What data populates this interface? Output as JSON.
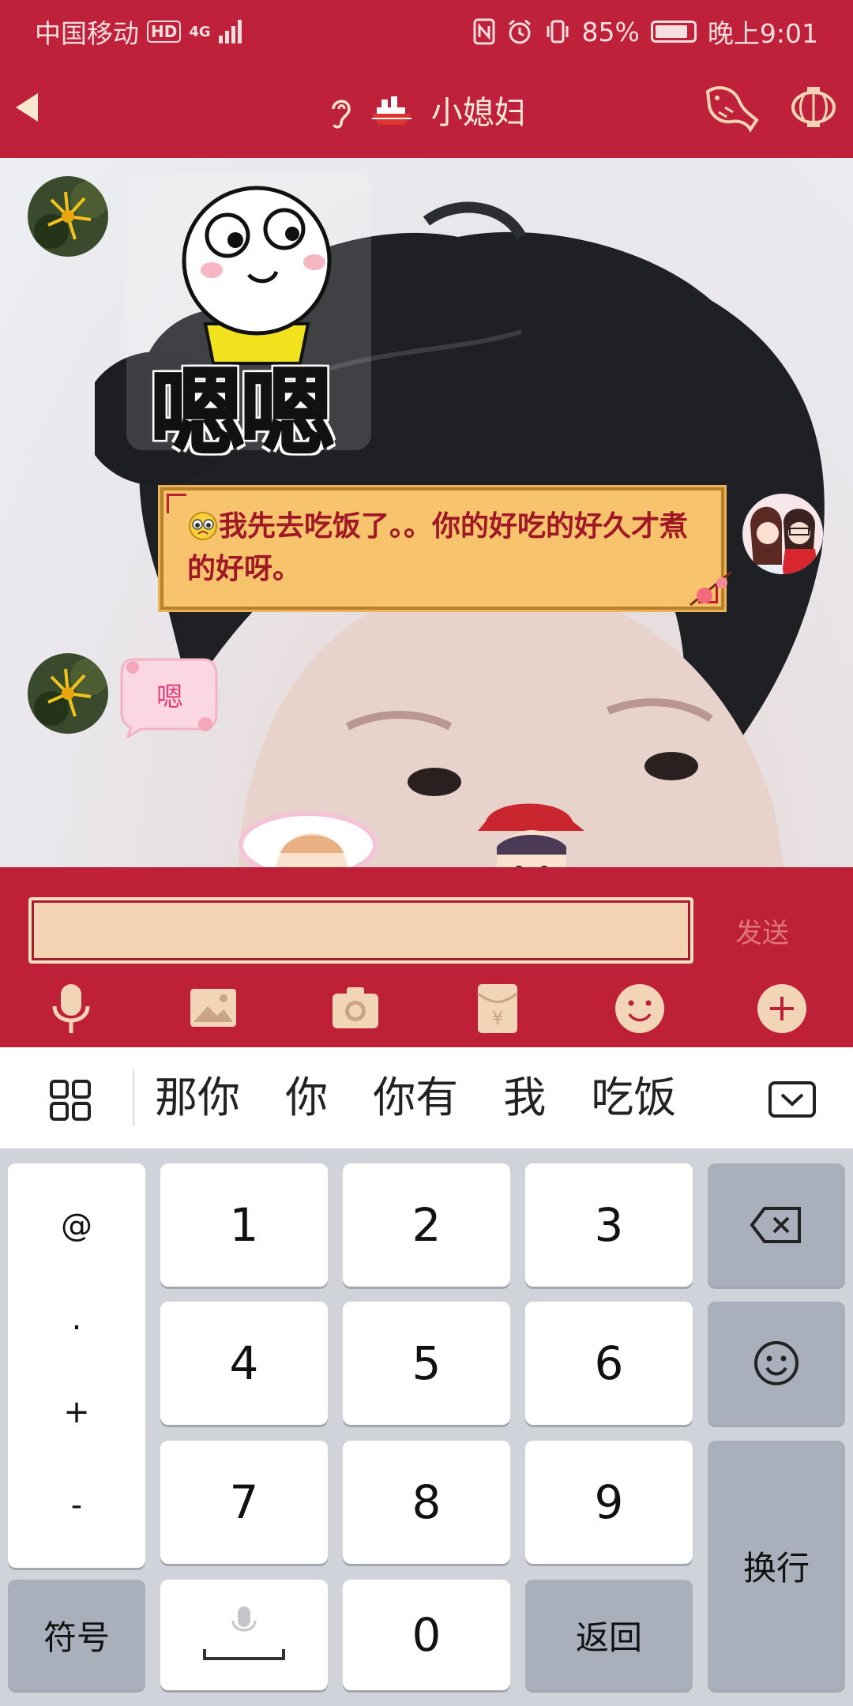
{
  "status_bar": {
    "carrier": "中国移动",
    "hd_badge": "HD",
    "network": "4G",
    "battery_percent": "85%",
    "time": "晚上9:01"
  },
  "header": {
    "title": "小媳妇",
    "icons": [
      "back-icon",
      "ear-icon",
      "ship-icon",
      "fish-icon",
      "lantern-icon"
    ]
  },
  "chat": {
    "sticker_text": "嗯嗯",
    "message_text": "我先去吃饭了。。你的好吃的好久才煮的好呀。",
    "small_sticker_text": "嗯"
  },
  "input_bar": {
    "input_value": "",
    "send_label": "发送",
    "tools": [
      "microphone-icon",
      "image-icon",
      "camera-icon",
      "red-packet-icon",
      "emoji-icon",
      "plus-icon"
    ]
  },
  "suggestions": {
    "candidates": [
      "那你",
      "你",
      "你有",
      "我",
      "吃饭"
    ]
  },
  "keyboard": {
    "symbols_col": [
      "@",
      ".",
      "+",
      "-"
    ],
    "digits": [
      "1",
      "2",
      "3",
      "4",
      "5",
      "6",
      "7",
      "8",
      "9",
      "0"
    ],
    "symbol_key": "符号",
    "return_key": "返回",
    "enter_key": "换行"
  },
  "colors": {
    "theme_red": "#c0213a",
    "bubble_gold": "#f7c36c",
    "bubble_text": "#a01825",
    "keyboard_bg": "#d0d3da"
  }
}
